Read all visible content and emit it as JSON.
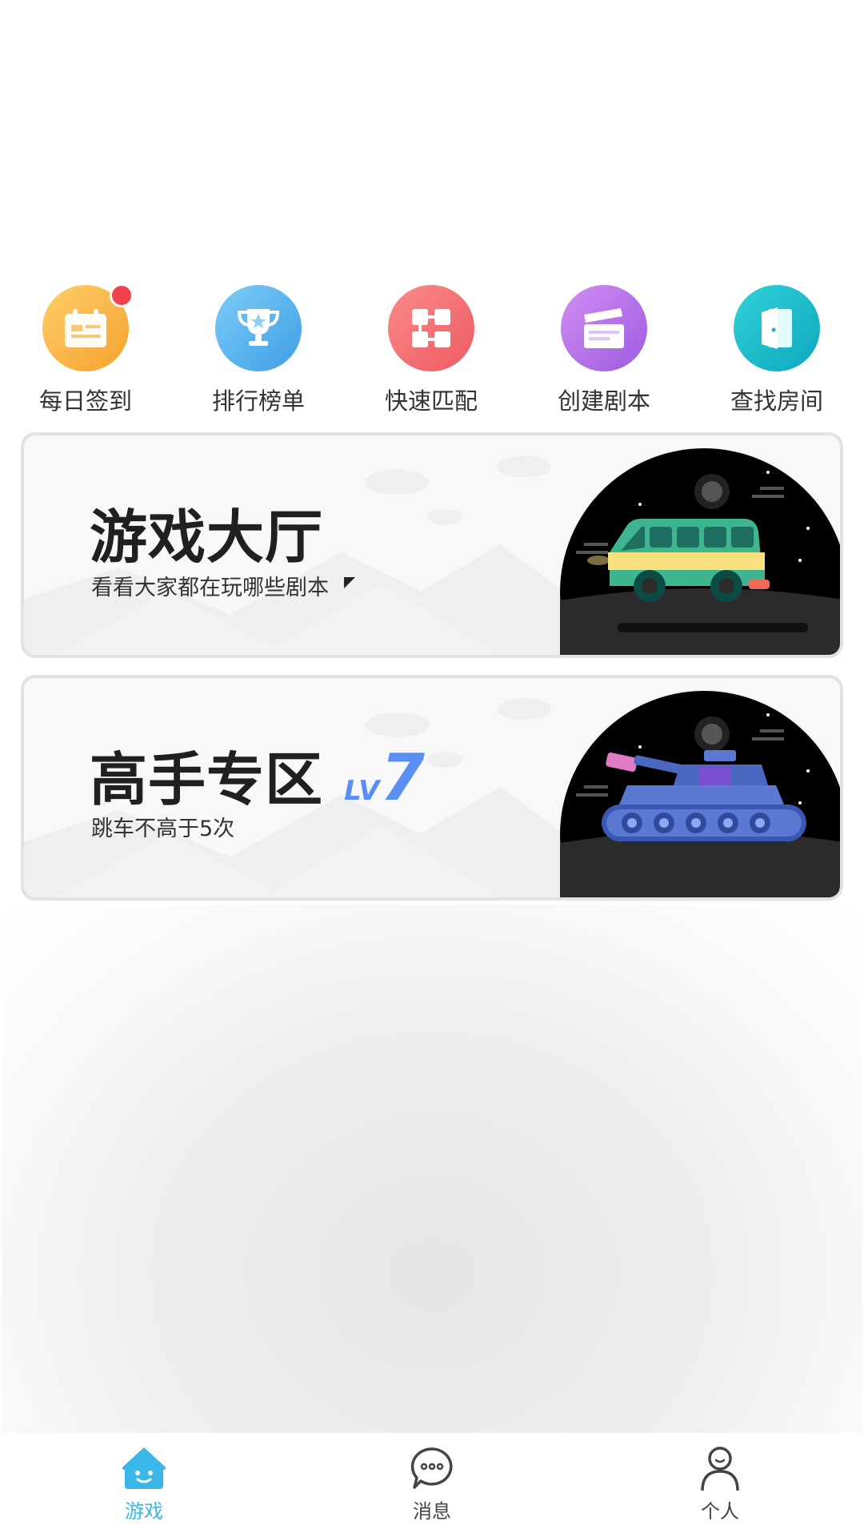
{
  "quick_actions": [
    {
      "label": "每日签到",
      "icon": "calendar-icon",
      "color": "#f9b03c",
      "badge": true
    },
    {
      "label": "排行榜单",
      "icon": "trophy-icon",
      "color": "#4eb0ee",
      "badge": false
    },
    {
      "label": "快速匹配",
      "icon": "match-grid-icon",
      "color": "#f2666a",
      "badge": false
    },
    {
      "label": "创建剧本",
      "icon": "clapperboard-icon",
      "color": "#b16de8",
      "badge": false
    },
    {
      "label": "查找房间",
      "icon": "door-icon",
      "color": "#13bcc8",
      "badge": false
    }
  ],
  "cards": [
    {
      "title": "游戏大厅",
      "subtitle": "看看大家都在玩哪些剧本",
      "illustration": "bus-icon"
    },
    {
      "title": "高手专区",
      "level_prefix": "LV",
      "level_num": "7",
      "subtitle": "跳车不高于5次",
      "illustration": "tank-icon"
    }
  ],
  "tabbar": [
    {
      "label": "游戏",
      "icon": "home-icon",
      "active": true
    },
    {
      "label": "消息",
      "icon": "chat-icon",
      "active": false
    },
    {
      "label": "个人",
      "icon": "person-icon",
      "active": false
    }
  ],
  "colors": {
    "accent": "#3bb6e8",
    "inactive": "#444444",
    "level": "#5b8ef2"
  }
}
